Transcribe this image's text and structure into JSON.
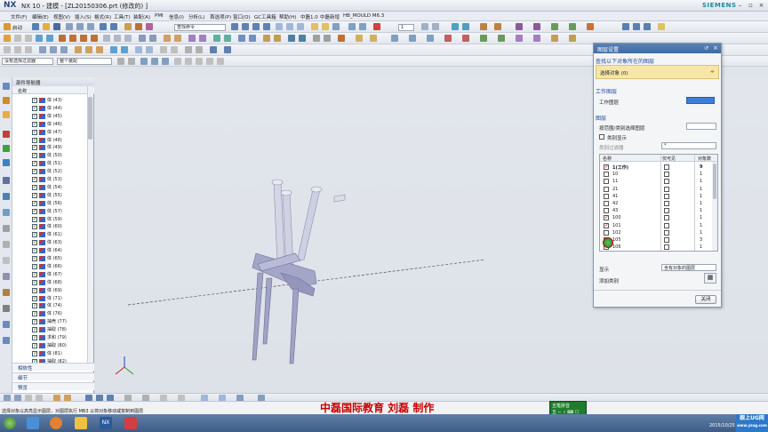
{
  "titlebar": {
    "logo": "NX",
    "title": "NX 10 - 建模 - [ZL20150306.prt  (修改的) ]",
    "brand": "SIEMENS"
  },
  "menus": [
    "文件(F)",
    "编辑(E)",
    "视图(V)",
    "插入(S)",
    "格式(R)",
    "工具(T)",
    "装配(A)",
    "PMI",
    "信息(I)",
    "分析(L)",
    "首选项(P)",
    "窗口(O)",
    "GC工具箱",
    "帮助(H)",
    "中磊1.0",
    "中磊新增",
    "HB_MOULD M6.3"
  ],
  "toolbar": {
    "start_label": "启动",
    "command_finder_placeholder": "查找命令",
    "layer_combo": "1",
    "filter_combo": "没有选择过滤器",
    "assembly_combo": "整个装配"
  },
  "navigator": {
    "title": "部件导航器",
    "col_name": "名称",
    "items": [
      "体 (43)",
      "体 (44)",
      "体 (45)",
      "体 (46)",
      "体 (47)",
      "体 (48)",
      "体 (49)",
      "体 (50)",
      "体 (51)",
      "体 (52)",
      "体 (53)",
      "体 (54)",
      "体 (55)",
      "体 (56)",
      "体 (57)",
      "体 (59)",
      "体 (60)",
      "体 (61)",
      "体 (63)",
      "体 (64)",
      "体 (65)",
      "体 (66)",
      "体 (67)",
      "体 (68)",
      "体 (69)",
      "体 (71)",
      "体 (74)",
      "体 (76)",
      "抽壳 (77)",
      "抽取 (78)",
      "求和 (79)",
      "抽取 (80)",
      "体 (81)",
      "抽取 (82)"
    ],
    "sections": [
      "相依性",
      "细节",
      "预览"
    ]
  },
  "dialog": {
    "title": "图层设置",
    "find_section": "查找以下对象所在的图层",
    "select_object": "选择对象 (0)",
    "work_layer_section": "工作图层",
    "work_layer_label": "工作图层",
    "work_layer_value": "1",
    "layers_section": "图层",
    "by_range": "按范围/类别选择图层",
    "show_category": "类别显示",
    "category_filter": "类别过滤器",
    "category_filter_value": "*",
    "col_name": "名称",
    "col_visible": "仅可见",
    "col_count": "对象数",
    "rows": [
      {
        "name": "1(工作)",
        "checked": true,
        "work": true,
        "count": "9"
      },
      {
        "name": "10",
        "checked": false,
        "count": "1"
      },
      {
        "name": "11",
        "checked": false,
        "count": "1"
      },
      {
        "name": "21",
        "checked": false,
        "count": "1"
      },
      {
        "name": "41",
        "checked": false,
        "count": "1"
      },
      {
        "name": "42",
        "checked": false,
        "count": "1"
      },
      {
        "name": "43",
        "checked": false,
        "count": "1"
      },
      {
        "name": "100",
        "checked": true,
        "count": "1"
      },
      {
        "name": "101",
        "checked": true,
        "count": "1"
      },
      {
        "name": "102",
        "checked": false,
        "count": "1"
      },
      {
        "name": "105",
        "checked": false,
        "count": "3"
      },
      {
        "name": "106",
        "checked": false,
        "count": "1"
      }
    ],
    "display_label": "显示",
    "display_value": "含有对象的图层",
    "add_category": "添加类别",
    "close_label": "关闭"
  },
  "status": {
    "text": "选择对象以高亮显示图层，对图层执行 MB3 以将对象移动或复制到图层"
  },
  "watermark": "中磊国际教育  刘磊  制作",
  "greenbox": {
    "line1": "五笔拼音",
    "line2": "五 ⌐ ∘ ⌨ ☐"
  },
  "ug_logo": {
    "line1": "跟上UG网",
    "line2": "www.yzug.com"
  },
  "taskbar": {
    "date": "2015/10/25 星期日"
  }
}
